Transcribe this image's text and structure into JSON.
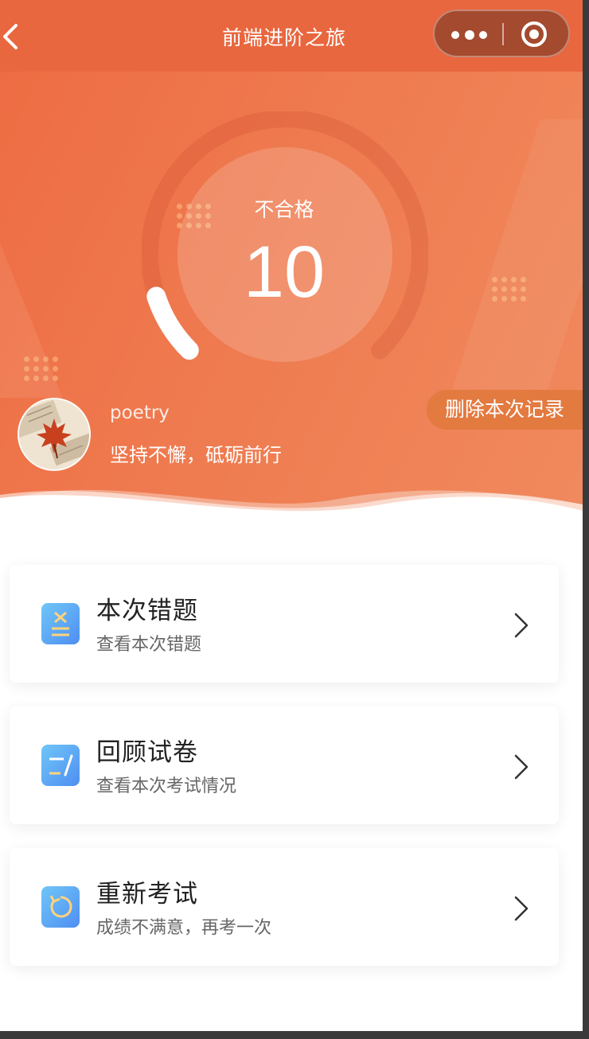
{
  "navbar": {
    "title": "前端进阶之旅",
    "back_icon": "chevron-left-icon",
    "more_icon": "more-dots-icon",
    "close_icon": "target-close-icon"
  },
  "result": {
    "status": "不合格",
    "score": "10",
    "progress_fraction": 0.1
  },
  "user": {
    "name": "poetry",
    "motto": "坚持不懈，砥砺前行",
    "avatar_icon": "maple-leaf-avatar"
  },
  "actions": {
    "delete_label": "删除本次记录"
  },
  "cards": [
    {
      "title": "本次错题",
      "subtitle": "查看本次错题",
      "icon": "wrong-questions-icon"
    },
    {
      "title": "回顾试卷",
      "subtitle": "查看本次考试情况",
      "icon": "review-paper-icon"
    },
    {
      "title": "重新考试",
      "subtitle": "成绩不满意，再考一次",
      "icon": "retake-icon"
    }
  ],
  "colors": {
    "header": "#ee6b42",
    "accent": "#e37a40",
    "icon_gradient_start": "#6fc6f8",
    "icon_gradient_end": "#4f8ef2"
  }
}
